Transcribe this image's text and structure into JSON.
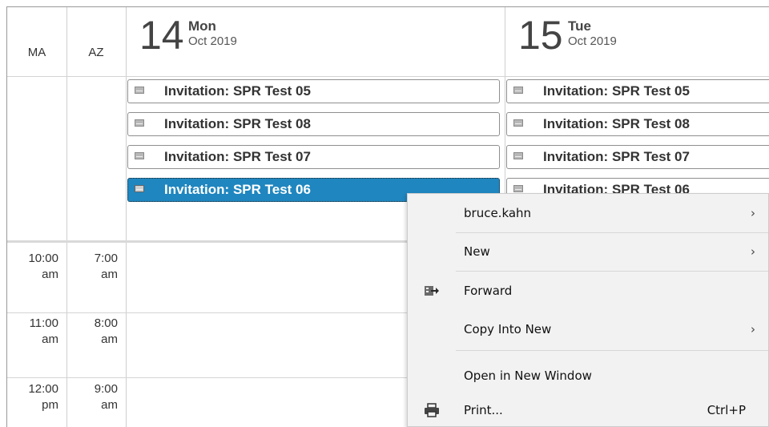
{
  "timezones": [
    "MA",
    "AZ"
  ],
  "days": [
    {
      "num": "14",
      "name": "Mon",
      "month": "Oct 2019"
    },
    {
      "num": "15",
      "name": "Tue",
      "month": "Oct 2019"
    }
  ],
  "events": [
    "Invitation: SPR Test 05",
    "Invitation: SPR Test 08",
    "Invitation: SPR Test 07",
    "Invitation: SPR Test 06"
  ],
  "times": [
    {
      "ma": [
        "10:00",
        "am"
      ],
      "az": [
        "7:00",
        "am"
      ]
    },
    {
      "ma": [
        "11:00",
        "am"
      ],
      "az": [
        "8:00",
        "am"
      ]
    },
    {
      "ma": [
        "12:00",
        "pm"
      ],
      "az": [
        "9:00",
        "am"
      ]
    }
  ],
  "menu": {
    "user": "bruce.kahn",
    "new": "New",
    "forward": "Forward",
    "copy_into_new": "Copy Into New",
    "open_new_window": "Open in New Window",
    "print": "Print...",
    "print_shortcut": "Ctrl+P",
    "arrow": "›"
  }
}
